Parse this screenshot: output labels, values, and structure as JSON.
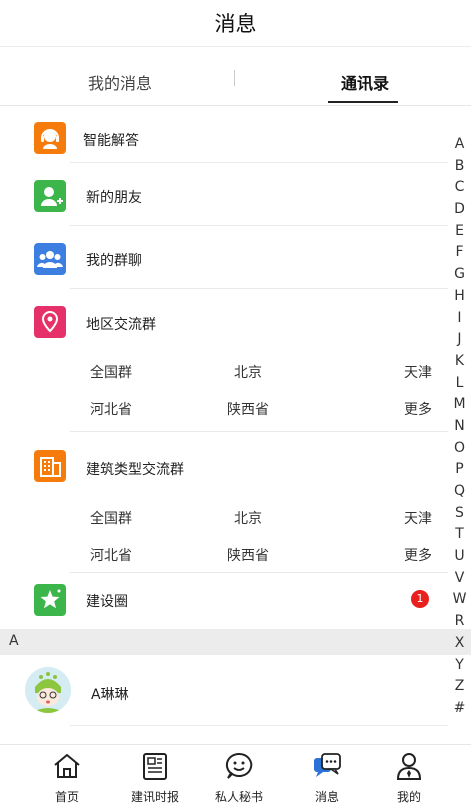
{
  "header": {
    "title": "消息"
  },
  "tabs": [
    {
      "label": "我的消息",
      "active": false
    },
    {
      "label": "通讯录",
      "active": true
    }
  ],
  "list": {
    "smart_answer": "智能解答",
    "new_friends": "新的朋友",
    "my_groups": "我的群聊",
    "regional_group": {
      "label": "地区交流群",
      "row1": [
        "全国群",
        "北京",
        "天津"
      ],
      "row2": [
        "河北省",
        "陕西省",
        "更多"
      ]
    },
    "building_group": {
      "label": "建筑类型交流群",
      "row1": [
        "全国群",
        "北京",
        "天津"
      ],
      "row2": [
        "河北省",
        "陕西省",
        "更多"
      ]
    },
    "circle": {
      "label": "建设圈",
      "badge": "1"
    }
  },
  "alphabet": [
    "A",
    "B",
    "C",
    "D",
    "E",
    "F",
    "G",
    "H",
    "I",
    "J",
    "K",
    "L",
    "M",
    "N",
    "O",
    "P",
    "Q",
    "S",
    "T",
    "U",
    "V",
    "W",
    "R",
    "X",
    "Y",
    "Z",
    "#"
  ],
  "section": {
    "letter": "A"
  },
  "contacts": [
    {
      "name": "A琳琳"
    }
  ],
  "nav": [
    {
      "label": "首页",
      "icon": "home-icon"
    },
    {
      "label": "建讯时报",
      "icon": "news-icon"
    },
    {
      "label": "私人秘书",
      "icon": "smile-icon"
    },
    {
      "label": "消息",
      "icon": "message-icon",
      "active": true
    },
    {
      "label": "我的",
      "icon": "user-icon"
    }
  ],
  "colors": {
    "smart_answer": "#f57c0c",
    "new_friends": "#3cb54a",
    "my_groups": "#3d7fe0",
    "regional_group": "#e6306a",
    "building_group": "#f57c0c",
    "circle": "#3cb54a",
    "badge": "#e8201e",
    "message_icon": "#2b71d6"
  }
}
